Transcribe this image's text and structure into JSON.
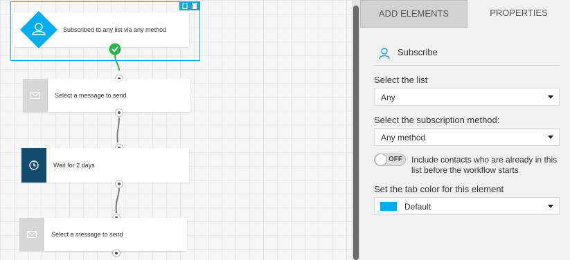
{
  "panel": {
    "tabs": [
      {
        "label": "ADD ELEMENTS",
        "active": false
      },
      {
        "label": "PROPERTIES",
        "active": true
      }
    ],
    "header": {
      "icon": "user-icon",
      "title": "Subscribe"
    },
    "list_label": "Select the list",
    "list_value": "Any",
    "method_label": "Select the subscription method:",
    "method_value": "Any method",
    "toggle_state": "OFF",
    "toggle_text": "Include contacts who are already in this list before the workflow starts",
    "color_label": "Set the tab color for this element",
    "color_value": "Default",
    "color_hex": "#00aeef"
  },
  "workflow": {
    "trigger": {
      "text": "Subscribed to any list via any method",
      "icon": "user-icon",
      "color": "#00aeef"
    },
    "steps": [
      {
        "text": "Select a message to send",
        "icon": "envelope-icon",
        "color": "#d7d7d7"
      },
      {
        "text": "Wait for 2 days",
        "icon": "clock-icon",
        "color": "#0f4c6e"
      },
      {
        "text": "Select a message to send",
        "icon": "envelope-icon",
        "color": "#d7d7d7"
      }
    ]
  }
}
